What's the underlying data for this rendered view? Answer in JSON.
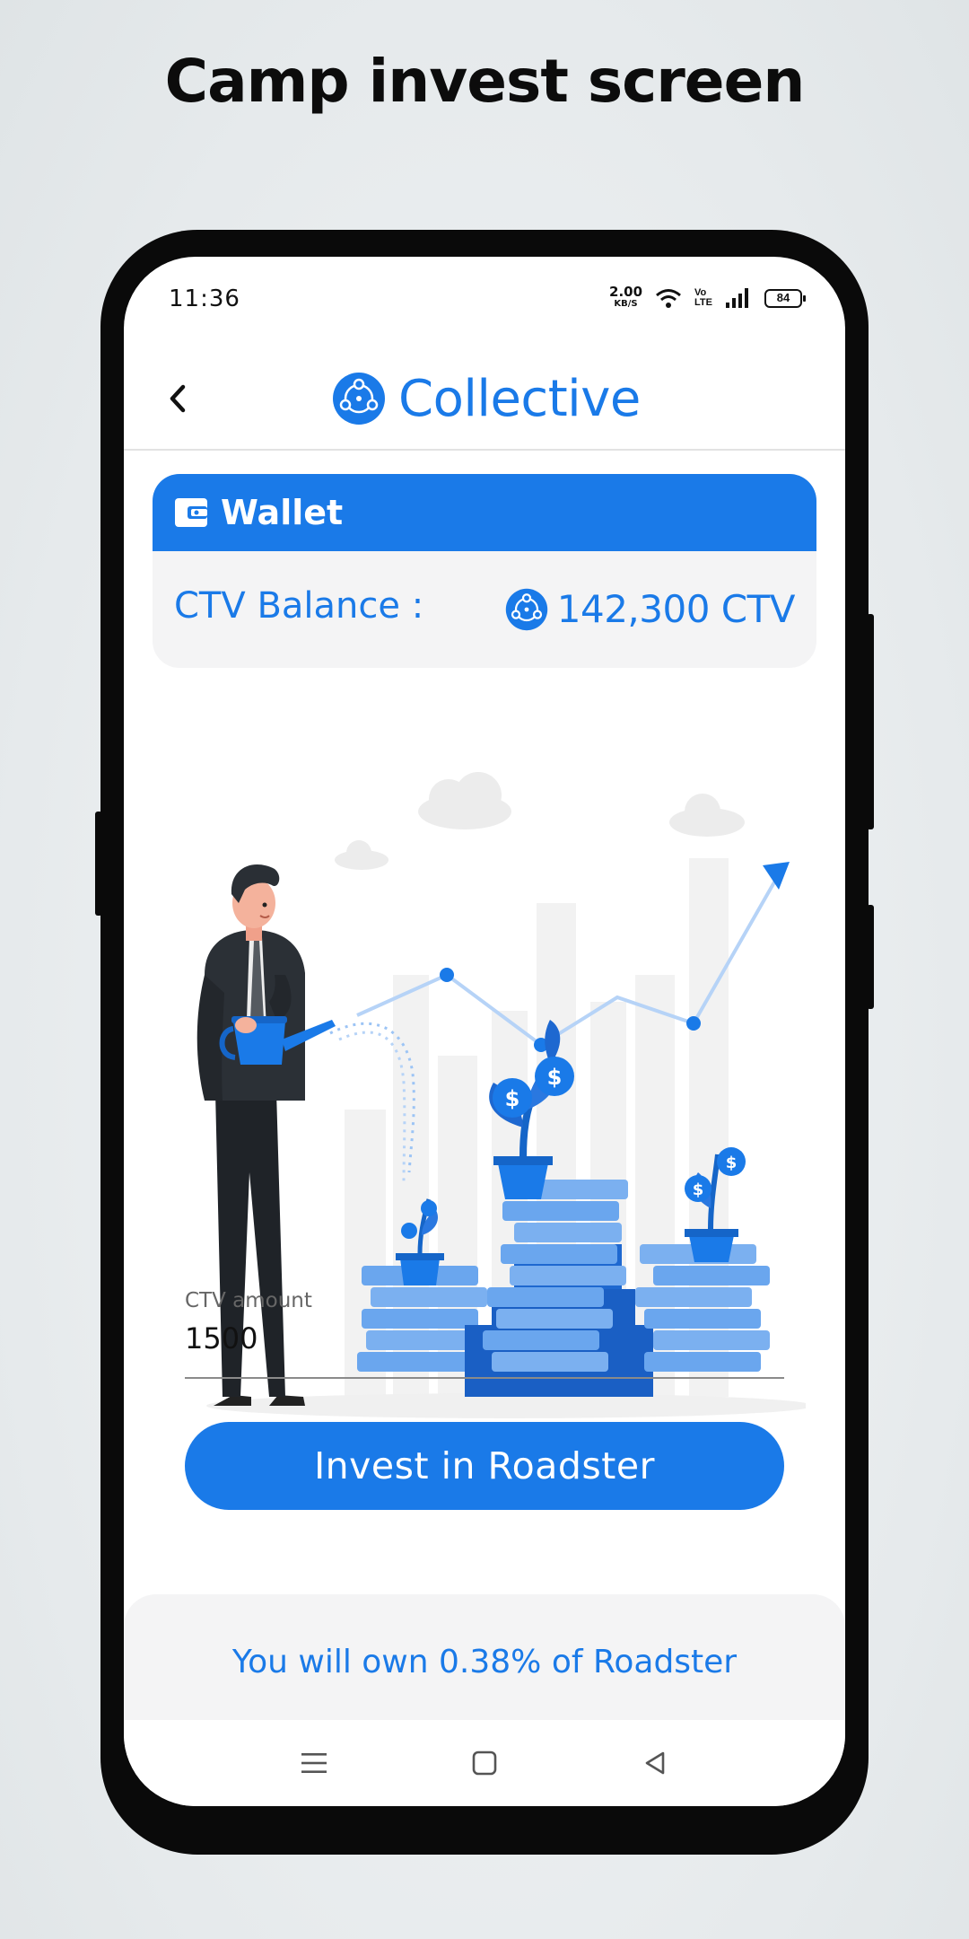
{
  "page": {
    "heading": "Camp invest screen"
  },
  "status_bar": {
    "time": "11:36",
    "net_speed": "2.00",
    "net_speed_unit": "KB/S",
    "volte_top": "Vo",
    "volte_bottom": "LTE",
    "battery": "84",
    "icons": [
      "wifi-icon",
      "signal-icon",
      "battery-icon"
    ]
  },
  "header": {
    "brand": "Collective",
    "icons": [
      "back-icon",
      "collective-logo-icon"
    ]
  },
  "wallet": {
    "title": "Wallet",
    "balance_label": "CTV Balance :",
    "balance_value": "142,300 CTV",
    "icons": [
      "wallet-icon",
      "ctv-coin-icon"
    ]
  },
  "form": {
    "amount_label": "CTV amount",
    "amount_value": "1500",
    "invest_label": "Invest in Roadster"
  },
  "ownership_text": "You will own 0.38% of Roadster",
  "nav": {
    "icons": [
      "menu-icon",
      "home-icon",
      "back-triangle-icon"
    ]
  },
  "colors": {
    "accent": "#1a7ae8",
    "card_bg": "#f4f4f5",
    "phone_frame": "#0a0a0a"
  }
}
